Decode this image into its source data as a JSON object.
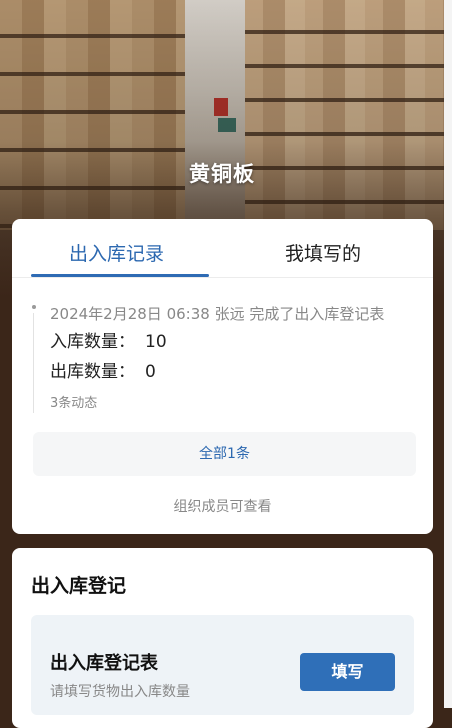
{
  "header": {
    "title": "黄铜板"
  },
  "tabs": [
    {
      "label": "出入库记录",
      "active": true
    },
    {
      "label": "我填写的",
      "active": false
    }
  ],
  "record": {
    "headline": "2024年2月28日 06:38  张远  完成了出入库登记表",
    "fields": [
      {
        "label": "入库数量：",
        "value": "10"
      },
      {
        "label": "出库数量：",
        "value": "0"
      }
    ],
    "activity_count": "3条动态"
  },
  "all_button_label": "全部1条",
  "footnote": "组织成员可查看",
  "register": {
    "section_title": "出入库登记",
    "form_name": "出入库登记表",
    "form_desc": "请填写货物出入库数量",
    "fill_label": "填写"
  },
  "colors": {
    "accent": "#2c68b0",
    "button": "#2f6fb8"
  }
}
